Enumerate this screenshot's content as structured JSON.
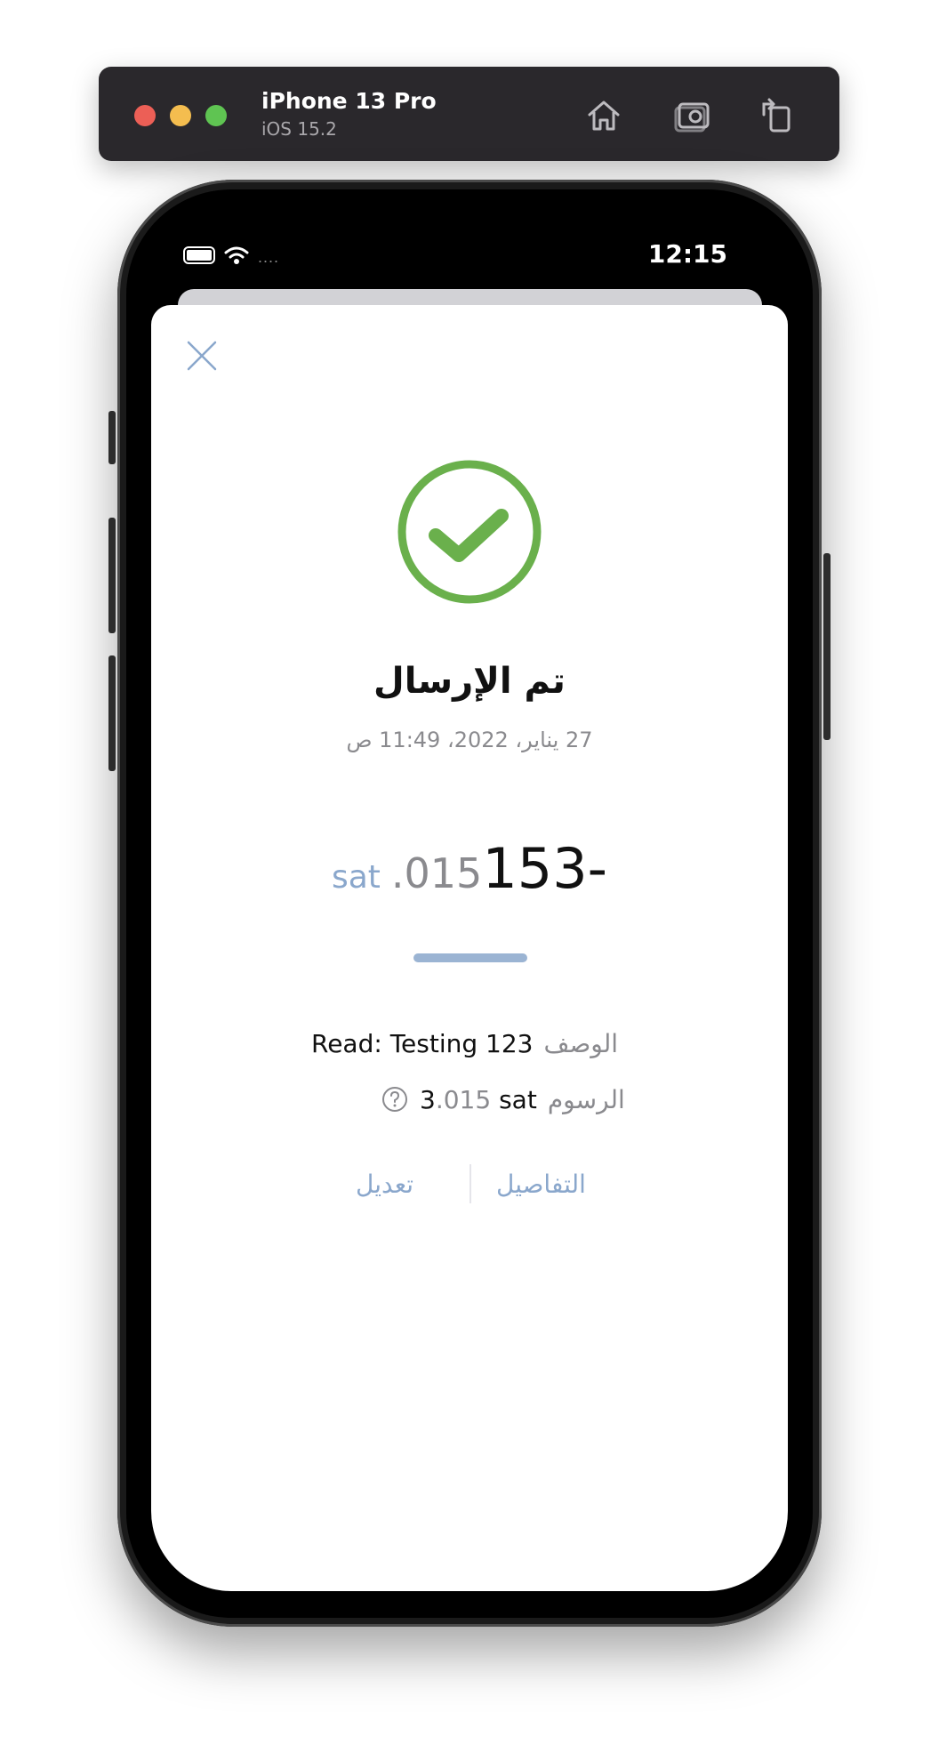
{
  "simulator": {
    "device_name": "iPhone 13 Pro",
    "os_version": "iOS 15.2",
    "icons": [
      "home-icon",
      "screenshot-icon",
      "rotate-icon"
    ]
  },
  "status_bar": {
    "time": "12:15",
    "signal_text": "....",
    "icons": [
      "battery-icon",
      "wifi-icon"
    ]
  },
  "sheet": {
    "title": "تم الإرسال",
    "date": "27 يناير، 2022، 11:49 ص",
    "amount": {
      "sign": "-",
      "whole": "153",
      "fraction": ".015",
      "unit": "sat"
    },
    "description": {
      "label": "الوصف",
      "value": "Read: Testing 123"
    },
    "fee": {
      "label": "الرسوم",
      "whole": "3",
      "fraction": ".015",
      "unit": "sat"
    },
    "actions": {
      "details": "التفاصيل",
      "edit": "تعديل"
    }
  },
  "colors": {
    "success_green": "#6ab04c",
    "accent_blue": "#8aa7cc",
    "toolbar_bg": "#2a282c"
  }
}
